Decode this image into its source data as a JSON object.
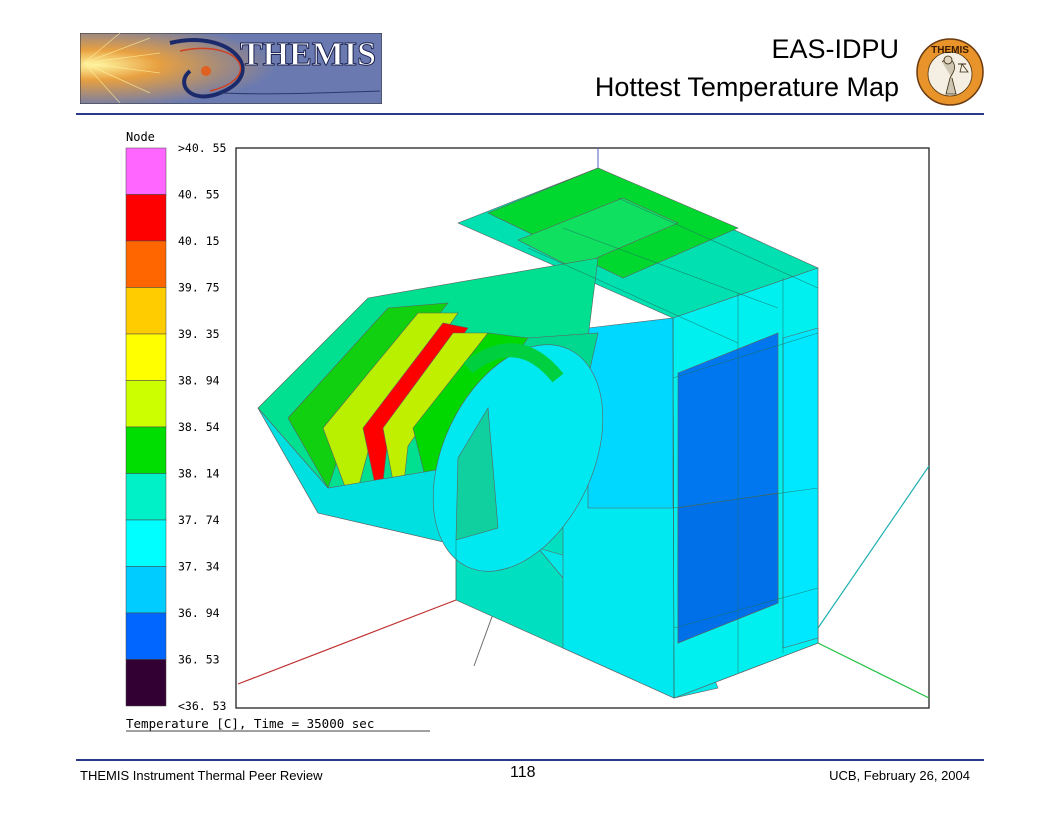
{
  "header": {
    "banner_text": "THEMIS",
    "title_line1": "EAS-IDPU",
    "title_line2": "Hottest Temperature Map",
    "seal_text": "THEMIS"
  },
  "figure": {
    "legend_title": "Node",
    "legend_labels": [
      ">40. 55",
      "40. 55",
      "40. 15",
      "39. 75",
      "39. 35",
      "38. 94",
      "38. 54",
      "38. 14",
      "37. 74",
      "37. 34",
      "36. 94",
      "36. 53",
      "<36. 53"
    ],
    "legend_colors": [
      "#ff66ff",
      "#ff0000",
      "#ff6600",
      "#ffcc00",
      "#ffff00",
      "#ccff00",
      "#00dd00",
      "#00f0c8",
      "#00ffff",
      "#00ccff",
      "#0066ff",
      "#330033"
    ],
    "caption": "Temperature [C], Time = 35000 sec"
  },
  "footer": {
    "left": "THEMIS Instrument Thermal Peer Review",
    "page_number": "118",
    "right": "UCB, February 26, 2004"
  },
  "colors": {
    "rule": "#2a3a8a"
  }
}
